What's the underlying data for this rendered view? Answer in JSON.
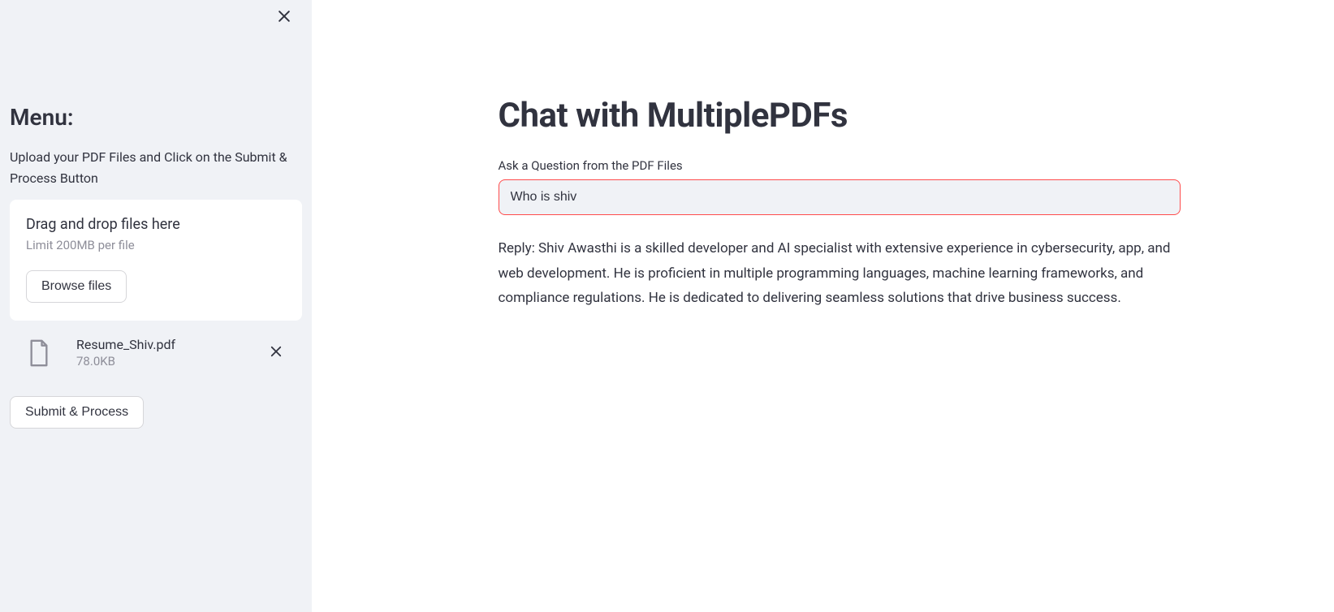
{
  "sidebar": {
    "title": "Menu:",
    "description": "Upload your PDF Files and Click on the Submit & Process Button",
    "dropzone": {
      "title": "Drag and drop files here",
      "limit": "Limit 200MB per file",
      "browse_label": "Browse files"
    },
    "files": [
      {
        "name": "Resume_Shiv.pdf",
        "size": "78.0KB"
      }
    ],
    "submit_label": "Submit & Process"
  },
  "main": {
    "title": "Chat with MultiplePDFs",
    "question_label": "Ask a Question from the PDF Files",
    "question_value": "Who is shiv",
    "reply": "Reply: Shiv Awasthi is a skilled developer and AI specialist with extensive experience in cybersecurity, app, and web development. He is proficient in multiple programming languages, machine learning frameworks, and compliance regulations. He is dedicated to delivering seamless solutions that drive business success."
  }
}
